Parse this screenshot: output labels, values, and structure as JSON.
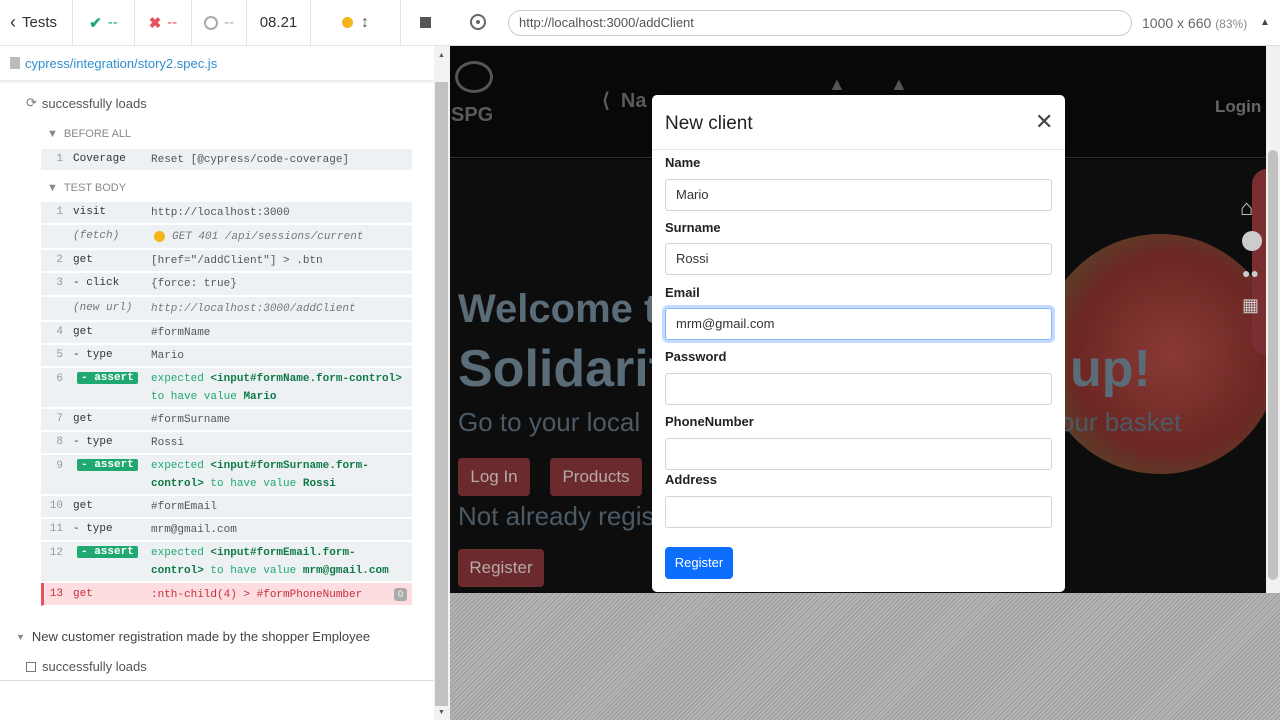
{
  "reporter": {
    "back_label": "Tests",
    "passed": "--",
    "failed": "--",
    "pending": "--",
    "duration": "08.21",
    "spec_file": "cypress/integration/story2.spec.js",
    "test_title": "successfully loads",
    "before_all_label": "BEFORE ALL",
    "test_body_label": "TEST BODY",
    "before_all_cmd": {
      "num": "1",
      "name": "Coverage",
      "msg": "Reset [@cypress/code-coverage]"
    },
    "commands": [
      {
        "num": "1",
        "name": "visit",
        "msg": "http://localhost:3000"
      },
      {
        "num": "",
        "name": "(fetch)",
        "msg": "GET 401 /api/sessions/current"
      },
      {
        "num": "2",
        "name": "get",
        "msg": "[href=\"/addClient\"] > .btn"
      },
      {
        "num": "3",
        "name": "- click",
        "msg": "{force: true}"
      },
      {
        "num": "",
        "name": "(new url)",
        "msg": "http://localhost:3000/addClient"
      },
      {
        "num": "4",
        "name": "get",
        "msg": "#formName"
      },
      {
        "num": "5",
        "name": "- type",
        "msg": "Mario"
      },
      {
        "num": "6",
        "name": "- assert",
        "msg1": "expected",
        "msg2": "<input#formName.form-control>",
        "msg3": "to have value",
        "msg4": "Mario"
      },
      {
        "num": "7",
        "name": "get",
        "msg": "#formSurname"
      },
      {
        "num": "8",
        "name": "- type",
        "msg": "Rossi"
      },
      {
        "num": "9",
        "name": "- assert",
        "msg1": "expected",
        "msg2": "<input#formSurname.form-control>",
        "msg3": "to have value",
        "msg4": "Rossi"
      },
      {
        "num": "10",
        "name": "get",
        "msg": "#formEmail"
      },
      {
        "num": "11",
        "name": "- type",
        "msg": "mrm@gmail.com"
      },
      {
        "num": "12",
        "name": "- assert",
        "msg1": "expected",
        "msg2": "<input#formEmail.form-control>",
        "msg3": "to have value",
        "msg4": "mrm@gmail.com"
      },
      {
        "num": "13",
        "name": "get",
        "msg": ":nth-child(4) > #formPhoneNumber",
        "badge": "0"
      }
    ],
    "suite2_title": "New customer registration made by the shopper Employee",
    "suite2_test": "successfully loads"
  },
  "browser": {
    "url": "http://localhost:3000/addClient",
    "size": "1000 x 660",
    "zoom": "(83%)"
  },
  "app": {
    "logo_text": "SPG",
    "nav_partial": "⟨  Na",
    "login": "Login",
    "welcome": "Welcome t",
    "solidarity": "Solidarit",
    "up": "up!",
    "go_to": "Go to your local",
    "basket": "our basket",
    "login_button": "Log In",
    "products_button": "Products",
    "not_already": "Not already regis",
    "register_button": "Register"
  },
  "modal": {
    "title": "New client",
    "fields": [
      {
        "label": "Name",
        "value": ""
      },
      {
        "label": "Surname",
        "value": ""
      },
      {
        "label": "Email",
        "value": ""
      },
      {
        "label": "Password",
        "value": ""
      },
      {
        "label": "PhoneNumber",
        "value": ""
      },
      {
        "label": "Address",
        "value": ""
      }
    ],
    "name_value": "Mario",
    "surname_value": "Rossi",
    "email_value": "mrm@gmail.com",
    "register": "Register"
  }
}
